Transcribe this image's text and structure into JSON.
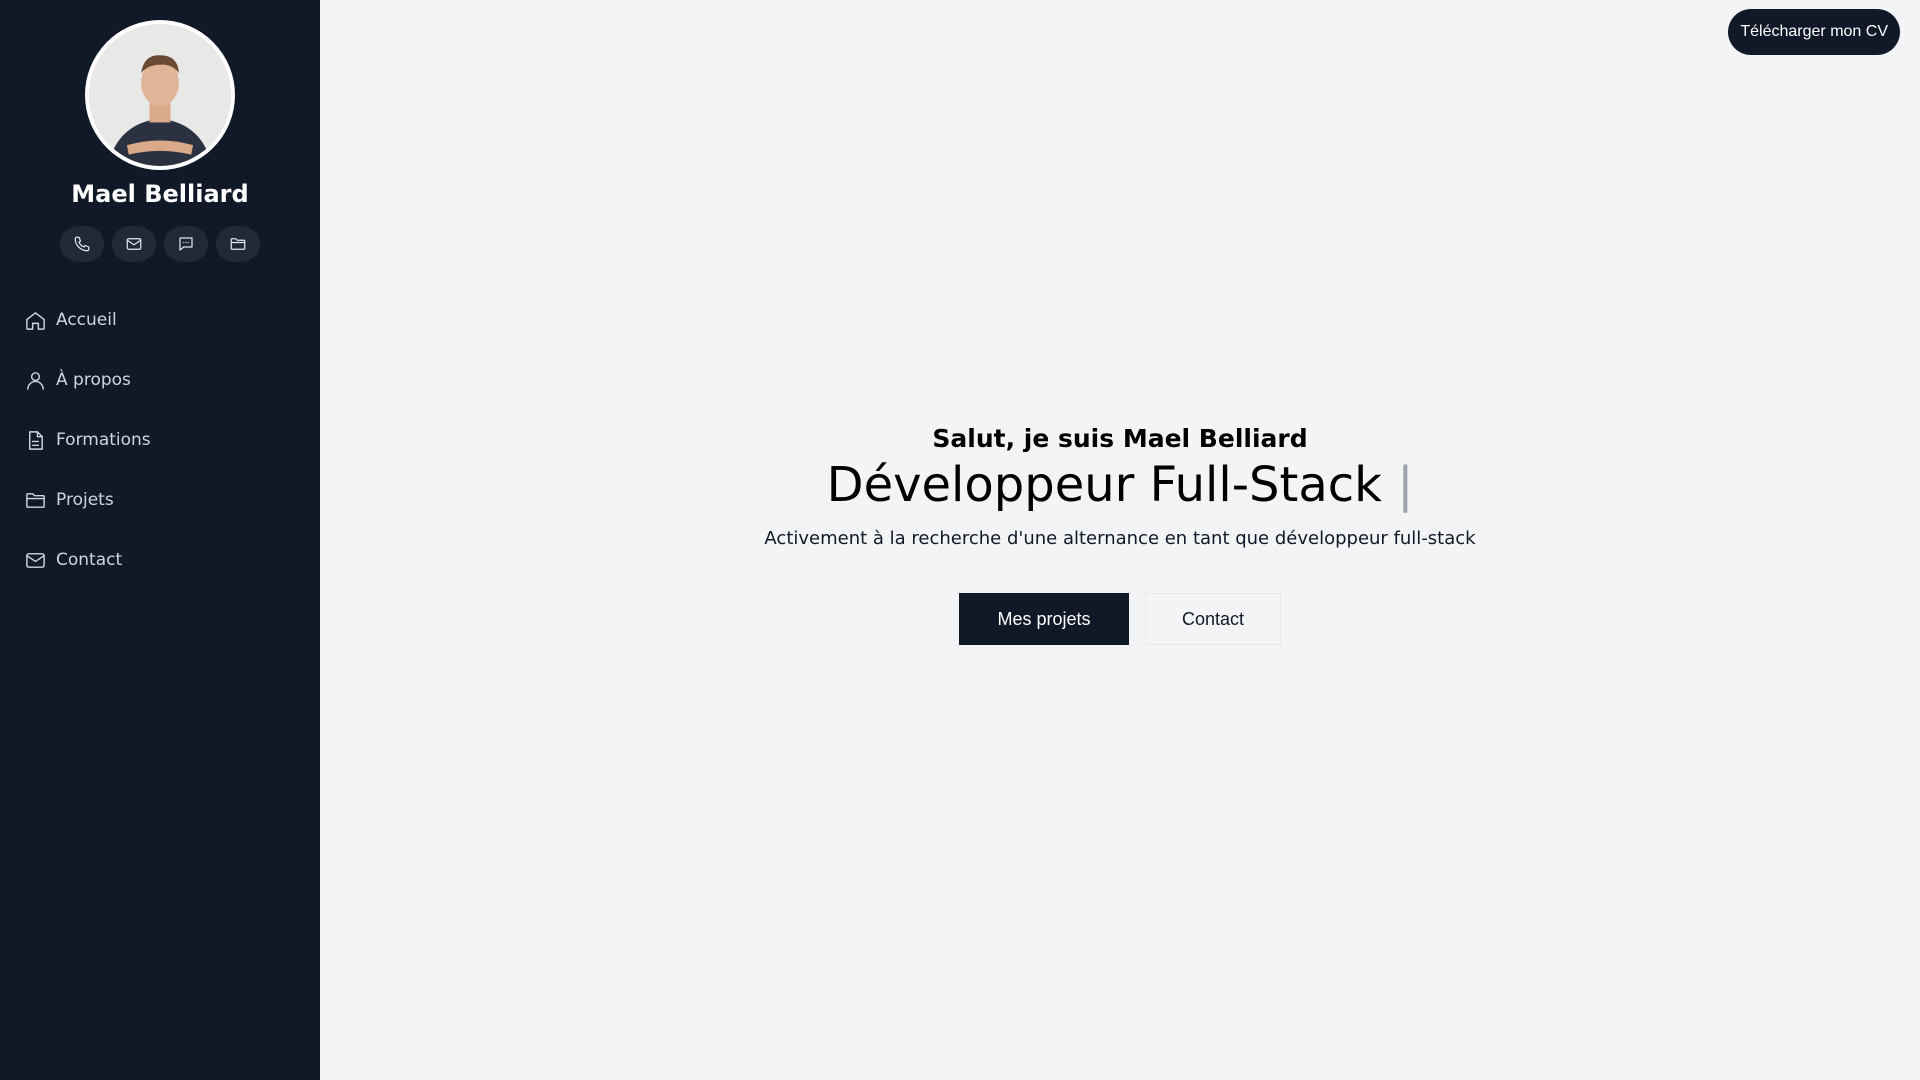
{
  "sidebar": {
    "profile_name": "Mael Belliard",
    "socials": [
      {
        "icon": "phone-icon"
      },
      {
        "icon": "mail-icon"
      },
      {
        "icon": "chat-icon"
      },
      {
        "icon": "folder-icon"
      }
    ],
    "nav": [
      {
        "label": "Accueil",
        "icon": "home-icon"
      },
      {
        "label": "À propos",
        "icon": "user-icon"
      },
      {
        "label": "Formations",
        "icon": "document-icon"
      },
      {
        "label": "Projets",
        "icon": "folder-icon"
      },
      {
        "label": "Contact",
        "icon": "mail-icon"
      }
    ]
  },
  "header": {
    "cv_button_label": "Télécharger mon CV"
  },
  "hero": {
    "greeting": "Salut, je suis Mael Belliard",
    "role": "Développeur Full-Stack",
    "cursor": "|",
    "tagline": "Activement à la recherche d'une alternance en tant que développeur full-stack",
    "primary_button": "Mes projets",
    "secondary_button": "Contact"
  },
  "colors": {
    "sidebar_bg": "#111827",
    "main_bg": "#f3f4f6",
    "accent_dark": "#111827"
  }
}
